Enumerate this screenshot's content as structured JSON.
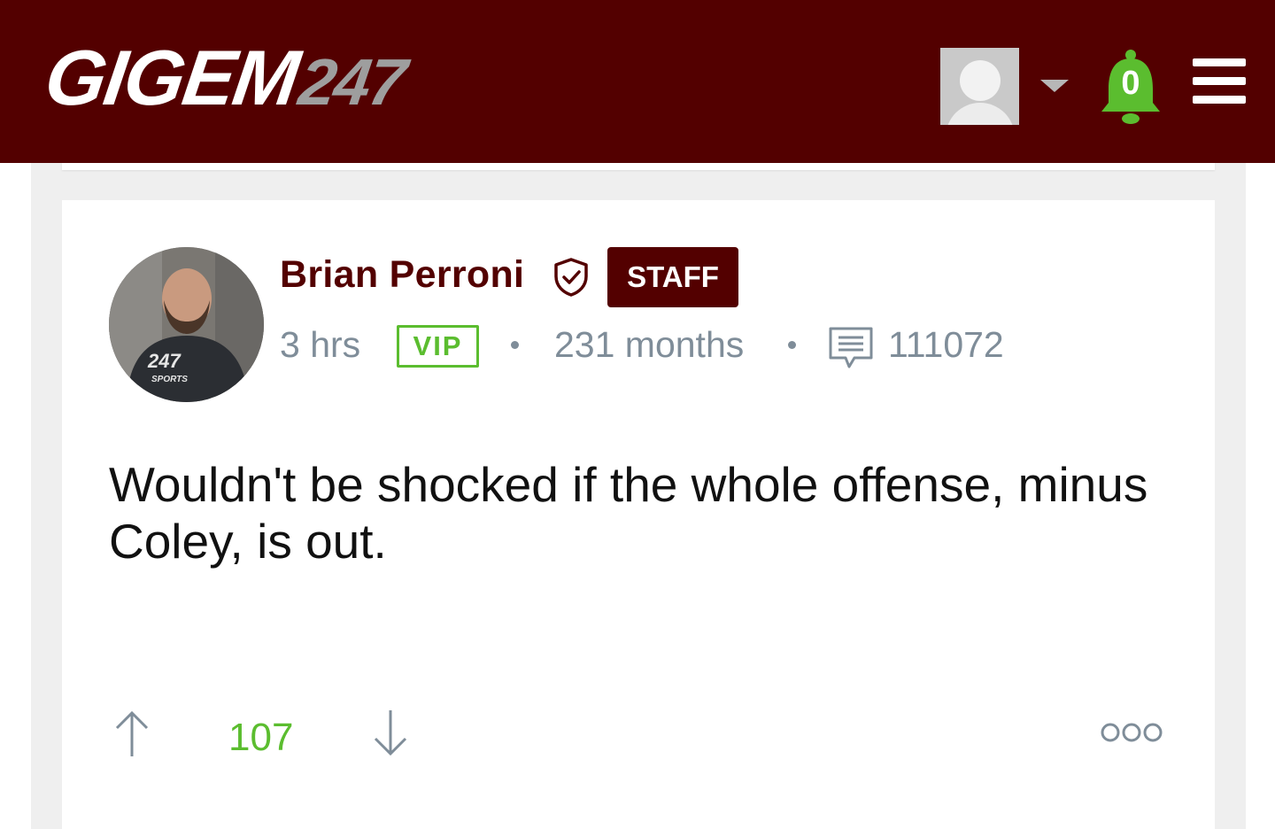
{
  "header": {
    "logo_brand": "GIGEM",
    "logo_number": "247",
    "notification_count": "0",
    "icons": [
      "user-avatar",
      "chevron-down-icon",
      "bell-icon",
      "menu-icon"
    ]
  },
  "post": {
    "author": "Brian Perroni",
    "badge": "STAFF",
    "time": "3 hrs",
    "membership": "VIP",
    "tenure": "231 months",
    "post_count": "111072",
    "body": "Wouldn't be shocked if the whole offense, minus Coley, is out.",
    "votes": "107"
  },
  "colors": {
    "brand": "#530000",
    "accent_green": "#5bbd2f",
    "meta_gray": "#7f8d99"
  }
}
